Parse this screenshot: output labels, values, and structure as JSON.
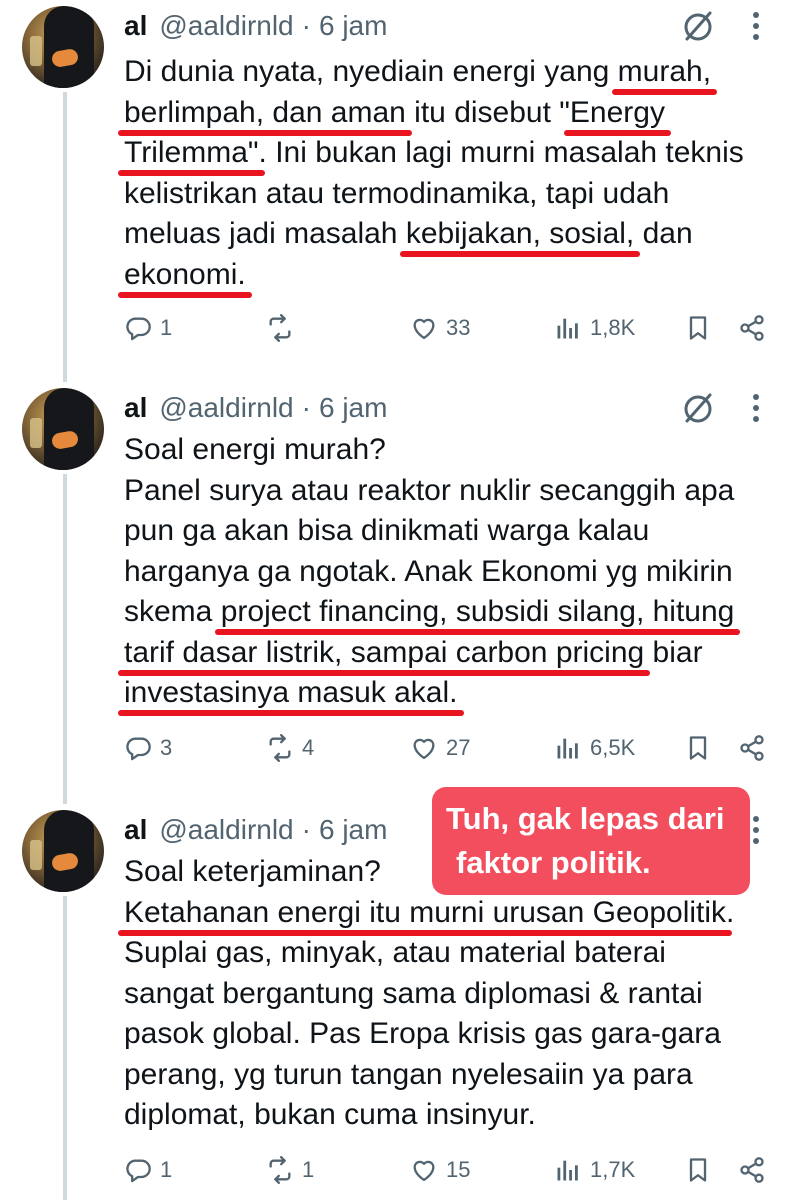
{
  "tweets": [
    {
      "name": "al",
      "handle": "@aaldirnld",
      "separator": "·",
      "time": "6 jam",
      "lines": [
        [
          {
            "t": "Di dunia nyata, nyediain energi yang "
          },
          {
            "t": "murah,",
            "u": true
          }
        ],
        [
          {
            "t": "berlimpah, dan aman",
            "u": true
          },
          {
            "t": " itu disebut \""
          },
          {
            "t": "Energy",
            "u": true
          }
        ],
        [
          {
            "t": "Trilemma\"",
            "u": true
          },
          {
            "t": ". Ini bukan lagi murni masalah teknis"
          }
        ],
        [
          {
            "t": "kelistrikan atau termodinamika, tapi udah"
          }
        ],
        [
          {
            "t": "meluas jadi masalah "
          },
          {
            "t": "kebijakan, sosial,",
            "u": true
          },
          {
            "t": " dan"
          }
        ],
        [
          {
            "t": "ekonomi.",
            "u": true
          }
        ]
      ],
      "stats": {
        "replies": "1",
        "reposts": "",
        "likes": "33",
        "views": "1,8K"
      }
    },
    {
      "name": "al",
      "handle": "@aaldirnld",
      "separator": "·",
      "time": "6 jam",
      "lines": [
        [
          {
            "t": "Soal energi murah?"
          }
        ],
        [
          {
            "t": "Panel surya atau reaktor nuklir secanggih apa"
          }
        ],
        [
          {
            "t": "pun ga akan bisa dinikmati warga kalau"
          }
        ],
        [
          {
            "t": "harganya ga ngotak. Anak Ekonomi yg mikirin"
          }
        ],
        [
          {
            "t": "skema "
          },
          {
            "t": "project financing, subsidi silang, hitung",
            "u": true
          }
        ],
        [
          {
            "t": "tarif dasar listrik, sampai carbon pricing",
            "u": true
          },
          {
            "t": " biar"
          }
        ],
        [
          {
            "t": "investasinya masuk akal.",
            "u": true
          }
        ]
      ],
      "stats": {
        "replies": "3",
        "reposts": "4",
        "likes": "27",
        "views": "6,5K"
      }
    },
    {
      "name": "al",
      "handle": "@aaldirnld",
      "separator": "·",
      "time": "6 jam",
      "lines": [
        [
          {
            "t": "Soal keterjaminan?"
          }
        ],
        [
          {
            "t": "Ketahanan energi itu murni urusan Geopolitik",
            "u": true
          },
          {
            "t": "."
          }
        ],
        [
          {
            "t": "Suplai gas, minyak, atau material baterai"
          }
        ],
        [
          {
            "t": "sangat bergantung sama diplomasi & rantai"
          }
        ],
        [
          {
            "t": "pasok global. Pas Eropa krisis gas gara-gara"
          }
        ],
        [
          {
            "t": "perang, yg turun tangan nyelesaiin ya para"
          }
        ],
        [
          {
            "t": "diplomat, bukan cuma insinyur."
          }
        ]
      ],
      "stats": {
        "replies": "1",
        "reposts": "1",
        "likes": "15",
        "views": "1,7K"
      }
    }
  ],
  "callout": {
    "line1": "Tuh, gak lepas dari",
    "line2": "faktor politik."
  },
  "colors": {
    "underline": "#e8141f",
    "callout_bg": "#f24e5e",
    "secondary_text": "#536471",
    "thread_line": "#cfd9de"
  },
  "icons": [
    "grok-icon",
    "more-icon",
    "reply-icon",
    "repost-icon",
    "like-icon",
    "views-icon",
    "bookmark-icon",
    "share-icon"
  ]
}
